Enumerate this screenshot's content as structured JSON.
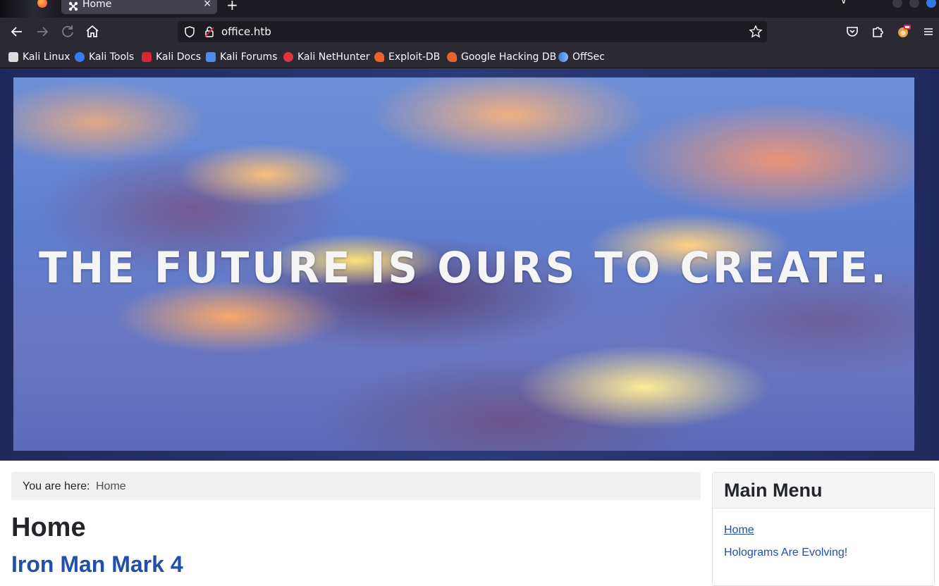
{
  "browser": {
    "tab": {
      "title": "Home",
      "close_glyph": "×",
      "icon": "joomla-icon"
    },
    "new_tab_glyph": "+",
    "address": "office.htb",
    "bookmarks": [
      {
        "label": "Kali Linux",
        "icon": "kali-dragon-icon",
        "color": "#3d3d3d"
      },
      {
        "label": "Kali Tools",
        "icon": "kali-tools-icon",
        "color": "#367bf0"
      },
      {
        "label": "Kali Docs",
        "icon": "kali-docs-icon",
        "color": "#d8253b"
      },
      {
        "label": "Kali Forums",
        "icon": "kali-forums-icon",
        "color": "#4d8de8"
      },
      {
        "label": "Kali NetHunter",
        "icon": "nethunter-icon",
        "color": "#e0353f"
      },
      {
        "label": "Exploit-DB",
        "icon": "exploit-db-icon",
        "color": "#e8632b"
      },
      {
        "label": "Google Hacking DB",
        "icon": "ghdb-icon",
        "color": "#e8632b"
      },
      {
        "label": "OffSec",
        "icon": "offsec-icon",
        "color": "#3b7ad9"
      }
    ]
  },
  "site": {
    "banner_text": "THE FUTURE IS OURS TO CREATE.",
    "breadcrumb": {
      "label": "You are here:",
      "current": "Home"
    },
    "page_title": "Home",
    "article_title": "Iron Man Mark 4",
    "menu": {
      "title": "Main Menu",
      "items": [
        {
          "label": "Home",
          "active": true
        },
        {
          "label": "Holograms Are Evolving!",
          "active": false
        }
      ]
    }
  },
  "colors": {
    "link": "#224faa",
    "chrome_dark": "#1c1b22",
    "chrome": "#2b2a33"
  }
}
